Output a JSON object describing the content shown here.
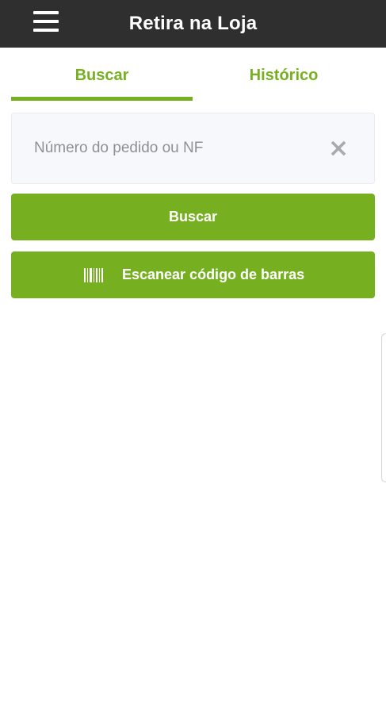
{
  "header": {
    "title": "Retira na Loja",
    "menu_icon": "hamburger-menu-icon"
  },
  "tabs": [
    {
      "label": "Buscar",
      "active": true
    },
    {
      "label": "Histórico",
      "active": false
    }
  ],
  "search": {
    "placeholder": "Número do pedido ou NF",
    "value": "",
    "clear_icon": "close-icon"
  },
  "buttons": {
    "search_label": "Buscar",
    "scan_label": "Escanear código de barras",
    "scan_icon": "barcode-icon"
  },
  "colors": {
    "accent": "#76b021",
    "header_bg": "#2f2f2f",
    "input_bg": "#f7f8fc",
    "placeholder": "#8e9097",
    "clear_icon": "#a7a9ae"
  }
}
